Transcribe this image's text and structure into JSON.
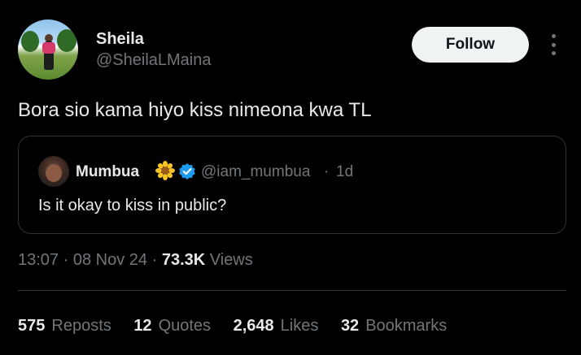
{
  "tweet": {
    "author_name": "Sheila",
    "author_handle": "@SheilaLMaina",
    "follow_label": "Follow",
    "text": "Bora sio kama hiyo kiss nimeona kwa TL",
    "time": "13:07",
    "date": "08 Nov 24",
    "views_count": "73.3K",
    "views_label": "Views",
    "separator": "·"
  },
  "quoted": {
    "author_name": "Mumbua",
    "author_handle": "@iam_mumbua",
    "time_ago": "1d",
    "text": "Is it okay to kiss in public?",
    "verified": true
  },
  "stats": [
    {
      "count": "575",
      "label": "Reposts"
    },
    {
      "count": "12",
      "label": "Quotes"
    },
    {
      "count": "2,648",
      "label": "Likes"
    },
    {
      "count": "32",
      "label": "Bookmarks"
    }
  ],
  "colors": {
    "background": "#000000",
    "text_primary": "#e7e9ea",
    "text_secondary": "#71767b",
    "border": "#2f3336",
    "verified_blue": "#1d9bf0",
    "follow_bg": "#eff3f4"
  },
  "icons": {
    "more": "more-options-icon",
    "verified": "verified-badge-icon",
    "flower": "sunflower-emoji-icon"
  }
}
